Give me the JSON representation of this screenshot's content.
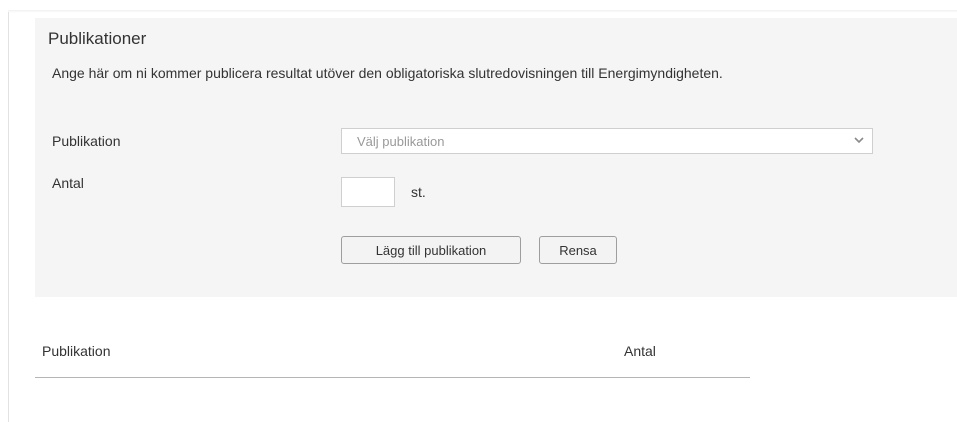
{
  "section": {
    "title": "Publikationer",
    "intro": "Ange här om ni kommer publicera resultat utöver den obligatoriska slutredovisningen till Energimyndigheten."
  },
  "form": {
    "publication_label": "Publikation",
    "publication_select": {
      "placeholder": "Välj publikation",
      "icon": "chevron-down-icon"
    },
    "quantity_label": "Antal",
    "quantity_value": "",
    "quantity_unit": "st.",
    "add_button_label": "Lägg till publikation",
    "clear_button_label": "Rensa"
  },
  "table": {
    "columns": [
      "Publikation",
      "Antal"
    ],
    "rows": []
  }
}
